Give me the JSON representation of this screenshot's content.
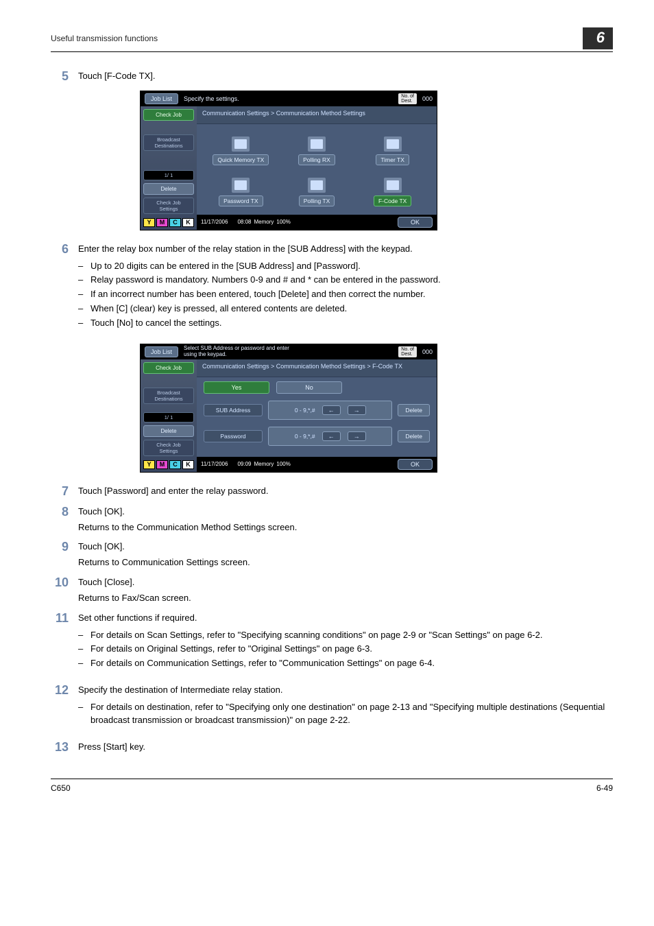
{
  "header": {
    "section_title": "Useful transmission functions",
    "chapter_number": "6"
  },
  "footer": {
    "model": "C650",
    "page_ref": "6-49"
  },
  "steps": {
    "s5": {
      "num": "5",
      "text": "Touch [F-Code TX]."
    },
    "s6": {
      "num": "6",
      "text": "Enter the relay box number of the relay station in the [SUB Address] with the keypad.",
      "b1": "Up to 20 digits can be entered in the [SUB Address] and [Password].",
      "b2": "Relay password is mandatory. Numbers 0-9 and # and * can be entered in the password.",
      "b3": "If an incorrect number has been entered, touch [Delete] and then correct the number.",
      "b4": "When [C] (clear) key is pressed, all entered contents are deleted.",
      "b5": "Touch [No] to cancel the settings."
    },
    "s7": {
      "num": "7",
      "text": "Touch [Password] and enter the relay password."
    },
    "s8": {
      "num": "8",
      "text": "Touch [OK].",
      "sub": "Returns to the Communication Method Settings screen."
    },
    "s9": {
      "num": "9",
      "text": "Touch [OK].",
      "sub": "Returns to Communication Settings screen."
    },
    "s10": {
      "num": "10",
      "text": "Touch [Close].",
      "sub": "Returns to Fax/Scan screen."
    },
    "s11": {
      "num": "11",
      "text": "Set other functions if required.",
      "b1": "For details on Scan Settings, refer to \"Specifying scanning conditions\" on page 2-9 or \"Scan Settings\" on page 6-2.",
      "b2": "For details on Original Settings, refer to \"Original Settings\" on page 6-3.",
      "b3": "For details on Communication Settings, refer to \"Communication Settings\" on page 6-4."
    },
    "s12": {
      "num": "12",
      "text": "Specify the destination of Intermediate relay station.",
      "b1": "For details on destination, refer to \"Specifying only one destination\" on page 2-13 and \"Specifying multiple destinations (Sequential broadcast transmission or broadcast transmission)\" on page 2-22."
    },
    "s13": {
      "num": "13",
      "text": "Press [Start] key."
    }
  },
  "shot1": {
    "job_list": "Job List",
    "check_job": "Check Job",
    "broadcast": "Broadcast\nDestinations",
    "pager": "1/  1",
    "delete": "Delete",
    "check_settings": "Check Job\nSettings",
    "prompt": "Specify the settings.",
    "dest_label": "No. of\nDest.",
    "dest_count": "000",
    "breadcrumb": "Communication Settings > Communication Method Settings",
    "btns": {
      "quick_memory": "Quick Memory TX",
      "polling_rx": "Polling RX",
      "timer": "Timer TX",
      "password": "Password TX",
      "polling_tx": "Polling TX",
      "fcode": "F-Code TX"
    },
    "date": "11/17/2006",
    "time": "08:08",
    "mem_label": "Memory",
    "mem_pct": "100%",
    "ok": "OK",
    "toner": {
      "y": "Y",
      "m": "M",
      "c": "C",
      "k": "K"
    }
  },
  "shot2": {
    "job_list": "Job List",
    "check_job": "Check Job",
    "broadcast": "Broadcast\nDestinations",
    "pager": "1/  1",
    "delete_side": "Delete",
    "check_settings": "Check Job\nSettings",
    "prompt": "Select SUB Address or password and enter\nusing the keypad.",
    "dest_label": "No. of\nDest.",
    "dest_count": "000",
    "breadcrumb": "Communication Settings > Communication Method Settings > F-Code TX",
    "yes": "Yes",
    "no": "No",
    "sub_address": "SUB Address",
    "password": "Password",
    "hint": "0 - 9,*,#",
    "delete": "Delete",
    "arrow_left": "←",
    "arrow_right": "→",
    "date": "11/17/2006",
    "time": "09:09",
    "mem_label": "Memory",
    "mem_pct": "100%",
    "ok": "OK",
    "toner": {
      "y": "Y",
      "m": "M",
      "c": "C",
      "k": "K"
    }
  }
}
